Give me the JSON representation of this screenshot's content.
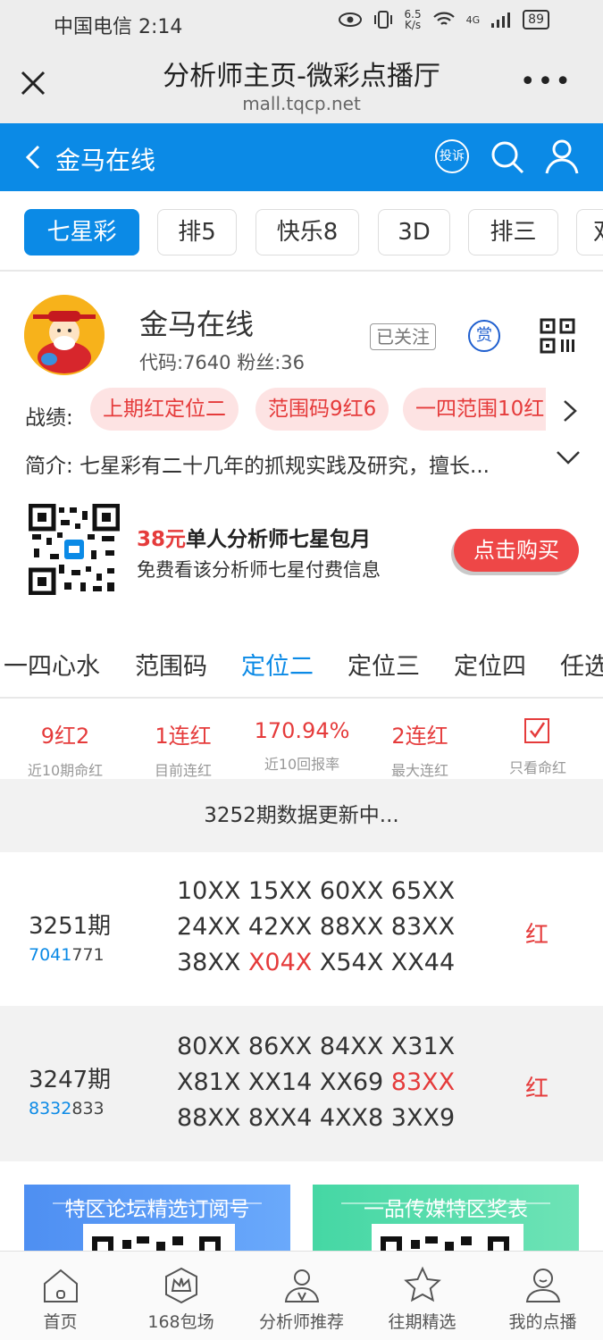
{
  "status_bar": {
    "carrier_time": "中国电信 2:14",
    "net_speed_value": "6.5",
    "net_speed_unit": "K/s",
    "battery": "89",
    "network": "4G"
  },
  "browser": {
    "title": "分析师主页-微彩点播厅",
    "url": "mall.tqcp.net"
  },
  "header": {
    "name": "金马在线",
    "complain_label": "投诉"
  },
  "lottery_tabs": [
    {
      "label": "七星彩",
      "active": true
    },
    {
      "label": "排5"
    },
    {
      "label": "快乐8"
    },
    {
      "label": "3D"
    },
    {
      "label": "排三"
    },
    {
      "label": "双"
    }
  ],
  "profile": {
    "name": "金马在线",
    "code_fans": "代码:7640  粉丝:36",
    "follow_label": "已关注",
    "reward_label": "赏",
    "record_label": "战绩:",
    "records": [
      "上期红定位二",
      "范围码9红6",
      "一四范围10红"
    ],
    "intro": "简介:  七星彩有二十几年的抓规实践及研究，擅长..."
  },
  "promo": {
    "price": "38元",
    "title_rest": "单人分析师七星包月",
    "subtitle": "免费看该分析师七星付费信息",
    "button": "点击购买"
  },
  "category_tabs": [
    "一四心水",
    "范围码",
    "定位二",
    "定位三",
    "定位四",
    "任选"
  ],
  "active_category": "定位二",
  "stats": [
    {
      "value": "9红2",
      "label": "近10期命红"
    },
    {
      "value": "1连红",
      "label": "目前连红"
    },
    {
      "value": "170.94%",
      "label": "近10回报率"
    },
    {
      "value": "2连红",
      "label": "最大连红"
    }
  ],
  "only_hits_label": "只看命红",
  "updating_text": "3252期数据更新中...",
  "records": [
    {
      "issue": "3251期",
      "code_highlight": "7041",
      "code_rest": "771",
      "lines": [
        [
          {
            "t": "10XX 15XX 60XX 65XX"
          }
        ],
        [
          {
            "t": "24XX 42XX 88XX 83XX"
          }
        ],
        [
          {
            "t": "38XX "
          },
          {
            "t": "X04X",
            "hit": true
          },
          {
            "t": " X54X XX44"
          }
        ]
      ],
      "result": "红"
    },
    {
      "issue": "3247期",
      "code_highlight": "8332",
      "code_rest": "833",
      "lines": [
        [
          {
            "t": "80XX 86XX 84XX X31X"
          }
        ],
        [
          {
            "t": "X81X XX14 XX69 "
          },
          {
            "t": "83XX",
            "hit": true
          }
        ],
        [
          {
            "t": "88XX 8XX4 4XX8 3XX9"
          }
        ]
      ],
      "result": "红"
    }
  ],
  "banners": [
    "特区论坛精选订阅号",
    "一品传媒特区奖表"
  ],
  "colors": {
    "brand_blue": "#0b8ae6",
    "red": "#e53b3b"
  },
  "bottom_nav": [
    {
      "label": "首页",
      "icon": "home-icon"
    },
    {
      "label": "168包场",
      "icon": "crown-icon"
    },
    {
      "label": "分析师推荐",
      "icon": "analyst-icon"
    },
    {
      "label": "往期精选",
      "icon": "star-icon"
    },
    {
      "label": "我的点播",
      "icon": "profile-icon"
    }
  ]
}
